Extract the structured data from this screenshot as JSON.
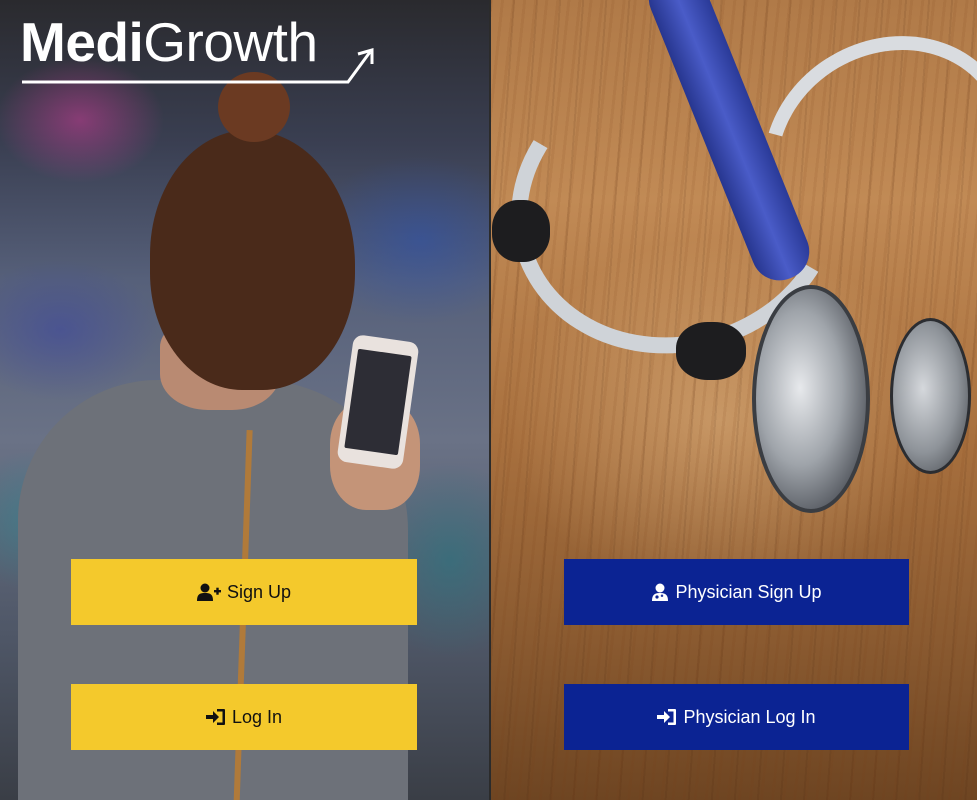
{
  "logo": {
    "brand_part1": "Medi",
    "brand_part2": "Growth",
    "color": "#ffffff"
  },
  "patient": {
    "signup_label": "Sign Up",
    "signup_icon": "user-plus-icon",
    "login_label": "Log In",
    "login_icon": "sign-in-icon",
    "button_color": "#f4c92c"
  },
  "physician": {
    "signup_label": "Physician Sign Up",
    "signup_icon": "user-doctor-icon",
    "login_label": "Physician Log In",
    "login_icon": "sign-in-icon",
    "button_color": "#0b2393"
  }
}
